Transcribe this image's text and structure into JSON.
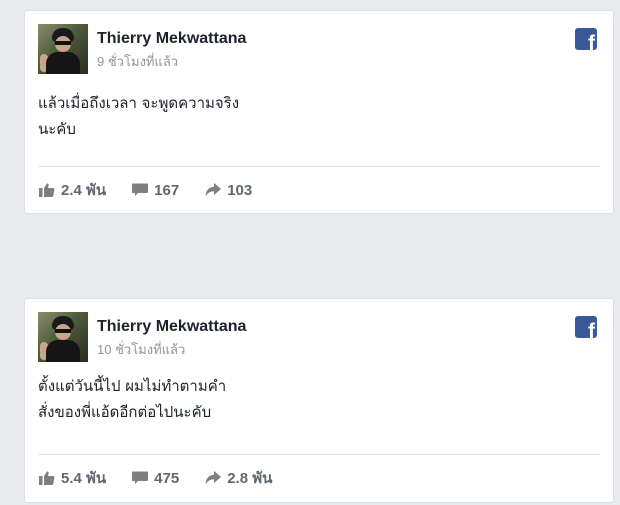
{
  "posts": [
    {
      "author": "Thierry Mekwattana",
      "time": "9 ชั่วโมงที่แล้ว",
      "lines": [
        "แล้วเมื่อถึงเวลา จะพูดความจริง",
        "นะคับ"
      ],
      "stats": {
        "likes": "2.4 พัน",
        "comments": "167",
        "shares": "103"
      }
    },
    {
      "author": "Thierry Mekwattana",
      "time": "10 ชั่วโมงที่แล้ว",
      "lines": [
        "ตั้งแต่วันนี้ไป ผมไม่ทำตามคำ",
        "สั่งของพี่แอ้ดอีกต่อไปนะคับ"
      ],
      "stats": {
        "likes": "5.4 พัน",
        "comments": "475",
        "shares": "2.8 พัน"
      }
    }
  ],
  "icons": {
    "like": "thumbs-up-icon",
    "comment": "comment-icon",
    "share": "share-arrow-icon",
    "facebook": "facebook-logo-icon"
  },
  "colors": {
    "background": "#e9ebee",
    "facebook_blue": "#3b5998",
    "muted_text": "#90949c",
    "action_text": "#616770"
  }
}
